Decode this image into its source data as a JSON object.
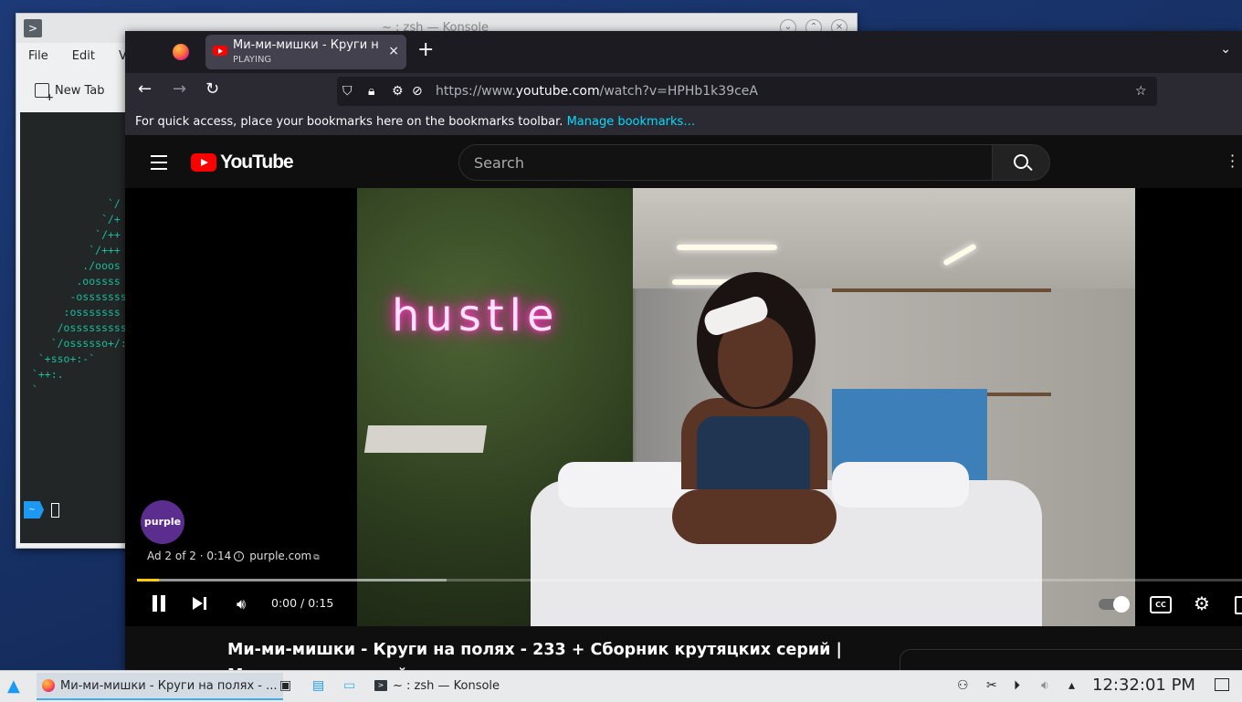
{
  "konsole": {
    "title": "~ : zsh — Konsole",
    "menu": [
      "File",
      "Edit",
      "View"
    ],
    "toolbar_new_tab": "New Tab",
    "ascii_art": "             `/\n            `/+\n           `/++\n          `/+++\n         ./ooos\n        .oossss\n       -osssssss\n      :osssssss\n     /osssssssss\n    `/ossssso+/:\n  `+sso+:-`\n `++:.\n `",
    "prompt_badge": "~"
  },
  "firefox": {
    "tab": {
      "title": "Ми-ми-мишки - Круги на",
      "status": "PLAYING",
      "close_label": "×"
    },
    "new_tab_label": "+",
    "url": {
      "prefix": "https://www.",
      "host": "youtube.com",
      "path": "/watch?v=HPHb1k39ceA"
    },
    "bookmarks_bar": {
      "message": "For quick access, place your bookmarks here on the bookmarks toolbar.",
      "link": "Manage bookmarks…"
    }
  },
  "youtube": {
    "logo_text": "YouTube",
    "search_placeholder": "Search",
    "video": {
      "neon_text": "hustle",
      "ad_advertiser_logo": "purple",
      "ad_label": "Ad 2 of 2 · 0:14",
      "ad_domain": "purple.com",
      "time": "0:00 / 0:15",
      "progress_played_fraction": 0.02,
      "progress_buffered_fraction": 0.28,
      "cc_label": "CC"
    },
    "title": "Ми-ми-мишки - Круги на полях - 233 + Сборник крутяцких серий | Мультик для детей"
  },
  "taskbar": {
    "tasks": [
      {
        "label": "Ми-ми-мишки - Круги на полях - ...",
        "icon": "firefox-icon"
      },
      {
        "label": "~ : zsh — Konsole",
        "icon": "konsole-icon"
      }
    ],
    "clock": "12:32:01 PM"
  },
  "colors": {
    "accent_blue": "#3daee9",
    "youtube_red": "#ff0000",
    "ad_yellow": "#ffcc00",
    "firefox_link": "#00ddff",
    "neon_pink": "#ff2bbf"
  }
}
